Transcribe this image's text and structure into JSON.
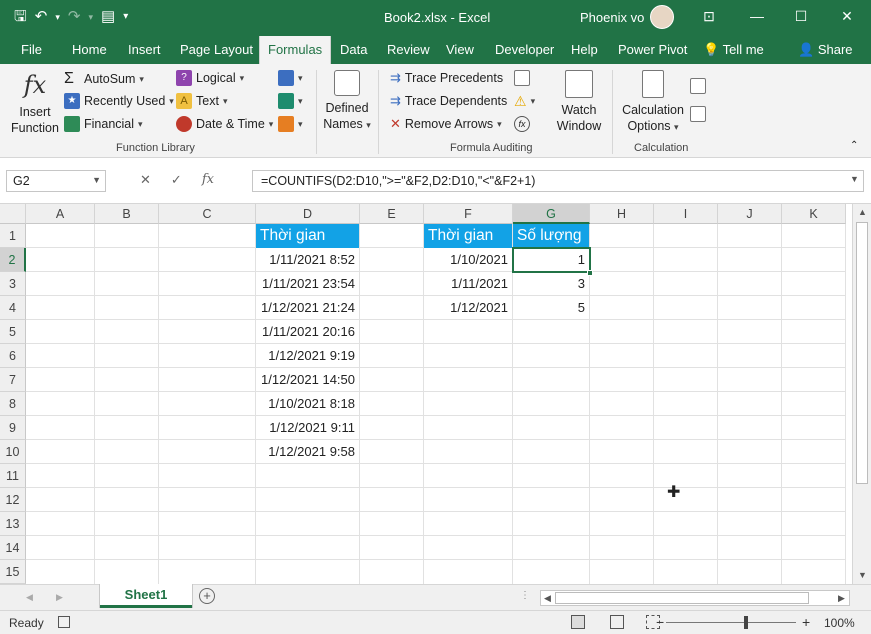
{
  "title_bar": {
    "file_title": "Book2.xlsx  -  Excel",
    "user_name": "Phoenix vo"
  },
  "tabs": [
    "File",
    "Home",
    "Insert",
    "Page Layout",
    "Formulas",
    "Data",
    "Review",
    "View",
    "Developer",
    "Help",
    "Power Pivot",
    "Tell me",
    "Share"
  ],
  "ribbon": {
    "insert_function": [
      "Insert",
      "Function"
    ],
    "autosum": "AutoSum",
    "recently_used": "Recently Used",
    "financial": "Financial",
    "logical": "Logical",
    "text": "Text",
    "date_time": "Date & Time",
    "function_library": "Function Library",
    "defined_names": [
      "Defined",
      "Names"
    ],
    "trace_precedents": "Trace Precedents",
    "trace_dependents": "Trace Dependents",
    "remove_arrows": "Remove Arrows",
    "watch_window": [
      "Watch",
      "Window"
    ],
    "formula_auditing": "Formula Auditing",
    "calc_options": [
      "Calculation",
      "Options"
    ],
    "calculation": "Calculation"
  },
  "formula_bar": {
    "name_box": "G2",
    "formula": "=COUNTIFS(D2:D10,\">=\"&F2,D2:D10,\"<\"&F2+1)"
  },
  "grid": {
    "columns": [
      "A",
      "B",
      "C",
      "D",
      "E",
      "F",
      "G",
      "H",
      "I",
      "J",
      "K"
    ],
    "rows": [
      "1",
      "2",
      "3",
      "4",
      "5",
      "6",
      "7",
      "8",
      "9",
      "10",
      "11",
      "12",
      "13",
      "14",
      "15"
    ],
    "D_header": "Thời gian",
    "D_values": [
      "1/11/2021 8:52",
      "1/11/2021 23:54",
      "1/12/2021 21:24",
      "1/11/2021 20:16",
      "1/12/2021 9:19",
      "1/12/2021 14:50",
      "1/10/2021 8:18",
      "1/12/2021 9:11",
      "1/12/2021 9:58"
    ],
    "F_header": "Thời gian",
    "F_values": [
      "1/10/2021",
      "1/11/2021",
      "1/12/2021"
    ],
    "G_header": "Số lượng",
    "G_values": [
      "1",
      "3",
      "5"
    ],
    "header_fill": "#12a2e6"
  },
  "sheets": {
    "active": "Sheet1"
  },
  "status": {
    "ready": "Ready",
    "zoom": "100%"
  },
  "colors": {
    "excel_green": "#217346"
  }
}
